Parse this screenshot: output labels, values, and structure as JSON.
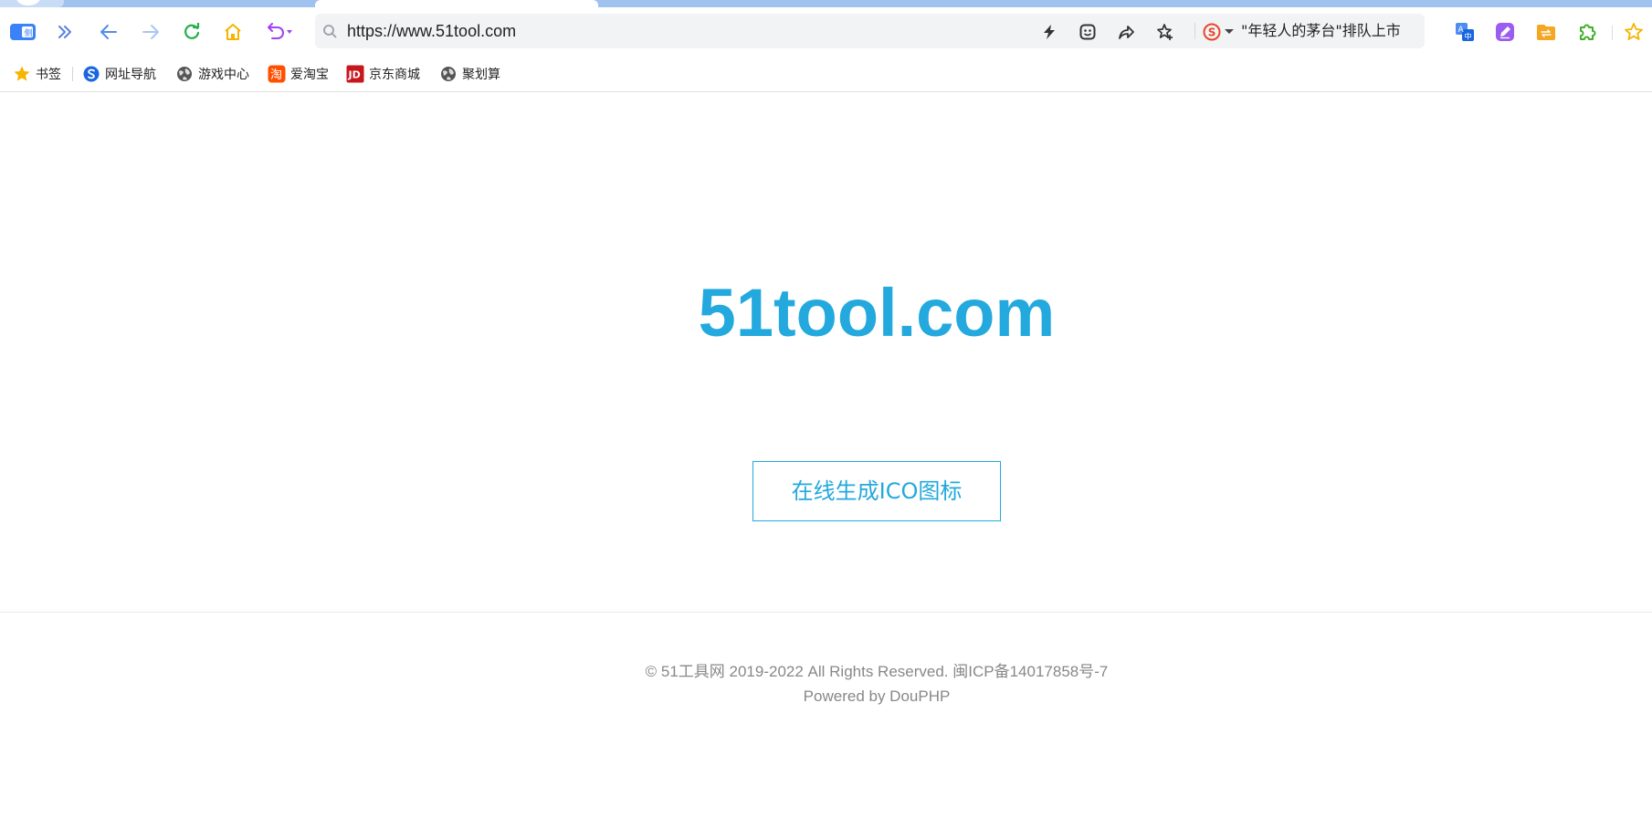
{
  "browser": {
    "address_bar": {
      "url": "https://www.51tool.com",
      "news_headline": "\"年轻人的茅台\"排队上市"
    },
    "sidebar_badge_text": "侧"
  },
  "bookmarks": [
    {
      "label": "书签",
      "icon": "star-icon"
    },
    {
      "label": "网址导航",
      "icon": "sogou-nav-icon"
    },
    {
      "label": "游戏中心",
      "icon": "globe-icon"
    },
    {
      "label": "爱淘宝",
      "icon": "taobao-icon"
    },
    {
      "label": "京东商城",
      "icon": "jd-icon"
    },
    {
      "label": "聚划算",
      "icon": "globe-icon"
    }
  ],
  "page": {
    "site_title": "51tool.com",
    "cta_label": "在线生成ICO图标",
    "footer": {
      "copyright": "© 51工具网 2019-2022 All Rights Reserved. 闽ICP备14017858号-7",
      "powered_prefix": "Powered by ",
      "powered_link": "DouPHP"
    }
  },
  "colors": {
    "accent": "#23a9dd",
    "footer_text": "#888888",
    "tab_strip": "#9fc2ef"
  }
}
